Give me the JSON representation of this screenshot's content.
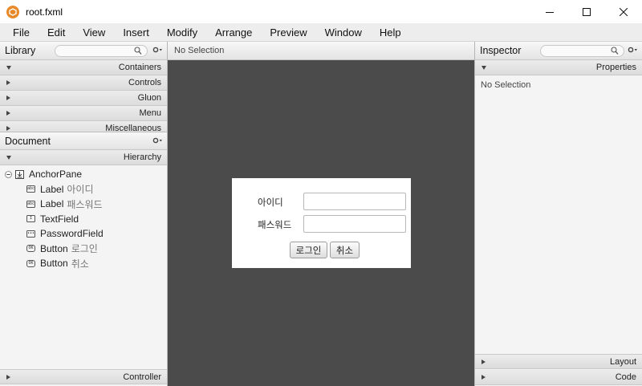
{
  "window": {
    "title": "root.fxml"
  },
  "menu": [
    "File",
    "Edit",
    "View",
    "Insert",
    "Modify",
    "Arrange",
    "Preview",
    "Window",
    "Help"
  ],
  "library": {
    "title": "Library",
    "sections": [
      "Containers",
      "Controls",
      "Gluon",
      "Menu",
      "Miscellaneous"
    ]
  },
  "document": {
    "title": "Document",
    "hierarchy_label": "Hierarchy",
    "tree": [
      {
        "type": "AnchorPane",
        "text": ""
      },
      {
        "type": "Label",
        "text": "아이디"
      },
      {
        "type": "Label",
        "text": "패스워드"
      },
      {
        "type": "TextField",
        "text": ""
      },
      {
        "type": "PasswordField",
        "text": ""
      },
      {
        "type": "Button",
        "text": "로그인"
      },
      {
        "type": "Button",
        "text": "취소"
      }
    ],
    "controller_label": "Controller"
  },
  "canvas": {
    "selection_label": "No Selection",
    "form": {
      "id_label": "아이디",
      "password_label": "패스워드",
      "login_button": "로그인",
      "cancel_button": "취소"
    }
  },
  "inspector": {
    "title": "Inspector",
    "properties_label": "Properties",
    "selection_label": "No Selection",
    "layout_label": "Layout",
    "code_label": "Code"
  },
  "colors": {
    "canvas_bg": "#4b4b4b",
    "app_icon": "#e8892a"
  }
}
